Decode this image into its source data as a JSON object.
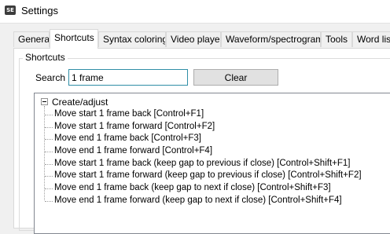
{
  "window": {
    "title": "Settings",
    "icon": "subtitle-edit-app-icon",
    "icon_text": "SE"
  },
  "tabs": [
    {
      "label": "General",
      "active": false
    },
    {
      "label": "Shortcuts",
      "active": true
    },
    {
      "label": "Syntax coloring",
      "active": false
    },
    {
      "label": "Video player",
      "active": false
    },
    {
      "label": "Waveform/spectrogram",
      "active": false
    },
    {
      "label": "Tools",
      "active": false
    },
    {
      "label": "Word lists",
      "active": false
    }
  ],
  "shortcuts": {
    "group_title": "Shortcuts",
    "search_label": "Search",
    "search_value": "1 frame",
    "clear_label": "Clear",
    "tree": {
      "root_label": "Create/adjust",
      "expanded": true,
      "items": [
        "Move start 1 frame back [Control+F1]",
        "Move start 1 frame forward [Control+F2]",
        "Move end 1 frame back [Control+F3]",
        "Move end 1 frame forward [Control+F4]",
        "Move start 1 frame back (keep gap to previous if close) [Control+Shift+F1]",
        "Move start 1 frame forward (keep gap to previous if close) [Control+Shift+F2]",
        "Move end 1 frame back  (keep gap to next if close) [Control+Shift+F3]",
        "Move end 1 frame forward  (keep gap to next if close) [Control+Shift+F4]"
      ]
    }
  },
  "colors": {
    "input_focus_border": "#2f8ea6",
    "tab_active_bg": "#ffffff",
    "window_bg": "#f0f0f0"
  }
}
